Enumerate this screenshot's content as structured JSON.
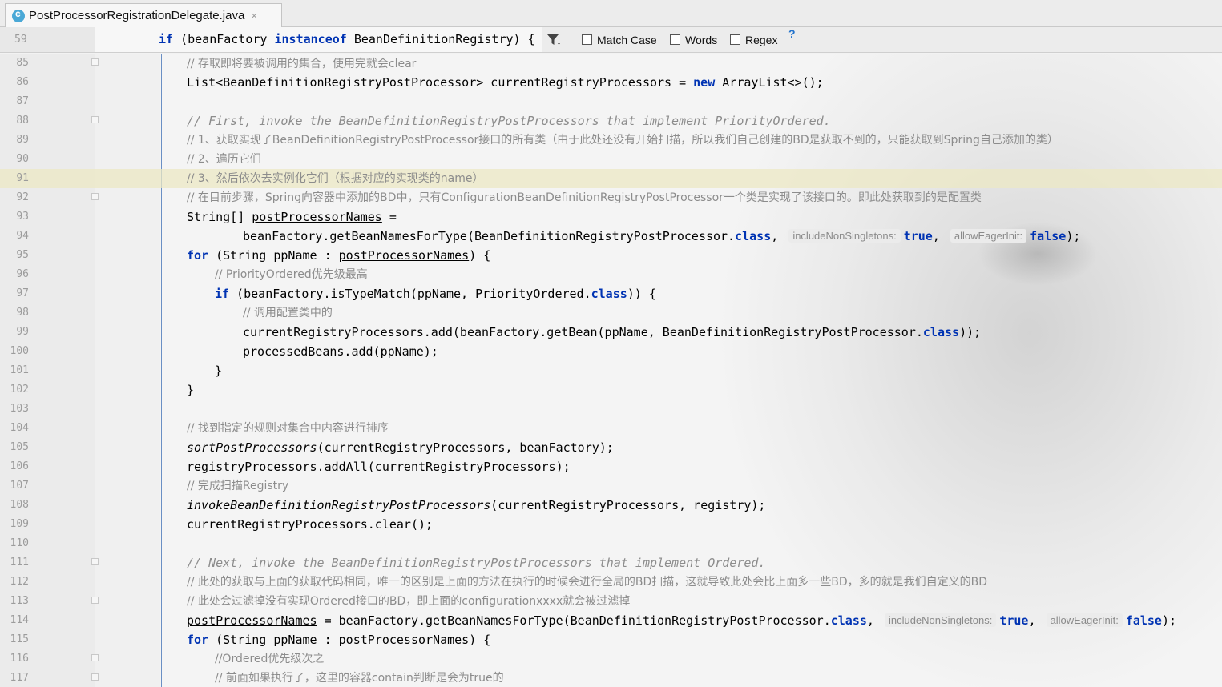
{
  "tab": {
    "file_name": "PostProcessorRegistrationDelegate.java",
    "icon": "java-class-icon",
    "close": "×"
  },
  "sticky": {
    "line_number": "59",
    "code": "if (beanFactory instanceof BeanDefinitionRegistry) {"
  },
  "search": {
    "match_case": "Match Case",
    "words": "Words",
    "regex": "Regex",
    "help": "?"
  },
  "lines": [
    {
      "num": "85"
    },
    {
      "num": "86"
    },
    {
      "num": "87"
    },
    {
      "num": "88"
    },
    {
      "num": "89"
    },
    {
      "num": "90"
    },
    {
      "num": "91"
    },
    {
      "num": "92"
    },
    {
      "num": "93"
    },
    {
      "num": "94"
    },
    {
      "num": "95"
    },
    {
      "num": "96"
    },
    {
      "num": "97"
    },
    {
      "num": "98"
    },
    {
      "num": "99"
    },
    {
      "num": "100"
    },
    {
      "num": "101"
    },
    {
      "num": "102"
    },
    {
      "num": "103"
    },
    {
      "num": "104"
    },
    {
      "num": "105"
    },
    {
      "num": "106"
    },
    {
      "num": "107"
    },
    {
      "num": "108"
    },
    {
      "num": "109"
    },
    {
      "num": "110"
    },
    {
      "num": "111"
    },
    {
      "num": "112"
    },
    {
      "num": "113"
    },
    {
      "num": "114"
    },
    {
      "num": "115"
    },
    {
      "num": "116"
    },
    {
      "num": "117"
    }
  ],
  "code": {
    "l85": "// 存取即将要被调用的集合，使用完就会clear",
    "l86": "List<BeanDefinitionRegistryPostProcessor> currentRegistryProcessors = new ArrayList<>();",
    "l88": "// First, invoke the BeanDefinitionRegistryPostProcessors that implement PriorityOrdered.",
    "l89": "// 1、获取实现了BeanDefinitionRegistryPostProcessor接口的所有类（由于此处还没有开始扫描，所以我们自己创建的BD是获取不到的，只能获取到Spring自己添加的类）",
    "l90": "// 2、遍历它们",
    "l91": "// 3、然后依次去实例化它们（根据对应的实现类的name）",
    "l92": "// 在目前步骤，Spring向容器中添加的BD中，只有ConfigurationBeanDefinitionRegistryPostProcessor一个类是实现了该接口的。即此处获取到的是配置类",
    "l93a": "String[] ",
    "l93b": "postProcessorNames",
    "l93c": " =",
    "l94a": "beanFactory.getBeanNamesForType(BeanDefinitionRegistryPostProcessor.",
    "l94b": "class",
    "l94c": ",",
    "l94h1": "includeNonSingletons:",
    "l94d": "true",
    "l94e": ",",
    "l94h2": "allowEagerInit:",
    "l94f": "false",
    "l94g": ");",
    "l95a": "for",
    "l95b": " (String ppName : ",
    "l95c": "postProcessorNames",
    "l95d": ") {",
    "l96": "// PriorityOrdered优先级最高",
    "l97a": "if",
    "l97b": " (beanFactory.isTypeMatch(ppName, PriorityOrdered.",
    "l97c": "class",
    "l97d": ")) {",
    "l98": "// 调用配置类中的",
    "l99a": "currentRegistryProcessors.add(beanFactory.getBean(ppName, BeanDefinitionRegistryPostProcessor.",
    "l99b": "class",
    "l99c": "));",
    "l100": "processedBeans.add(ppName);",
    "l101": "}",
    "l102": "}",
    "l104": "// 找到指定的规则对集合中内容进行排序",
    "l105a": "sortPostProcessors",
    "l105b": "(currentRegistryProcessors, beanFactory);",
    "l106": "registryProcessors.addAll(currentRegistryProcessors);",
    "l107": "// 完成扫描Registry",
    "l108a": "invokeBeanDefinitionRegistryPostProcessors",
    "l108b": "(currentRegistryProcessors, registry);",
    "l109": "currentRegistryProcessors.clear();",
    "l111": "// Next, invoke the BeanDefinitionRegistryPostProcessors that implement Ordered.",
    "l112": "// 此处的获取与上面的获取代码相同，唯一的区别是上面的方法在执行的时候会进行全局的BD扫描，这就导致此处会比上面多一些BD，多的就是我们自定义的BD",
    "l113": "// 此处会过滤掉没有实现Ordered接口的BD，即上面的configurationxxxx就会被过滤掉",
    "l114a": "postProcessorNames",
    "l114b": " = beanFactory.getBeanNamesForType(BeanDefinitionRegistryPostProcessor.",
    "l114c": "class",
    "l114d": ",",
    "l114h1": "includeNonSingletons:",
    "l114e": "true",
    "l114f": ",",
    "l114h2": "allowEagerInit:",
    "l114g": "false",
    "l114i": ");",
    "l115a": "for",
    "l115b": " (String ppName : ",
    "l115c": "postProcessorNames",
    "l115d": ") {",
    "l116": "//Ordered优先级次之",
    "l117": "// 前面如果执行了，这里的容器contain判断是会为true的"
  },
  "colors": {
    "keyword": "#0033b3",
    "comment": "#8c8c8c",
    "caret_line": "#ece8c4",
    "indent_guide": "#6a8fc4"
  }
}
